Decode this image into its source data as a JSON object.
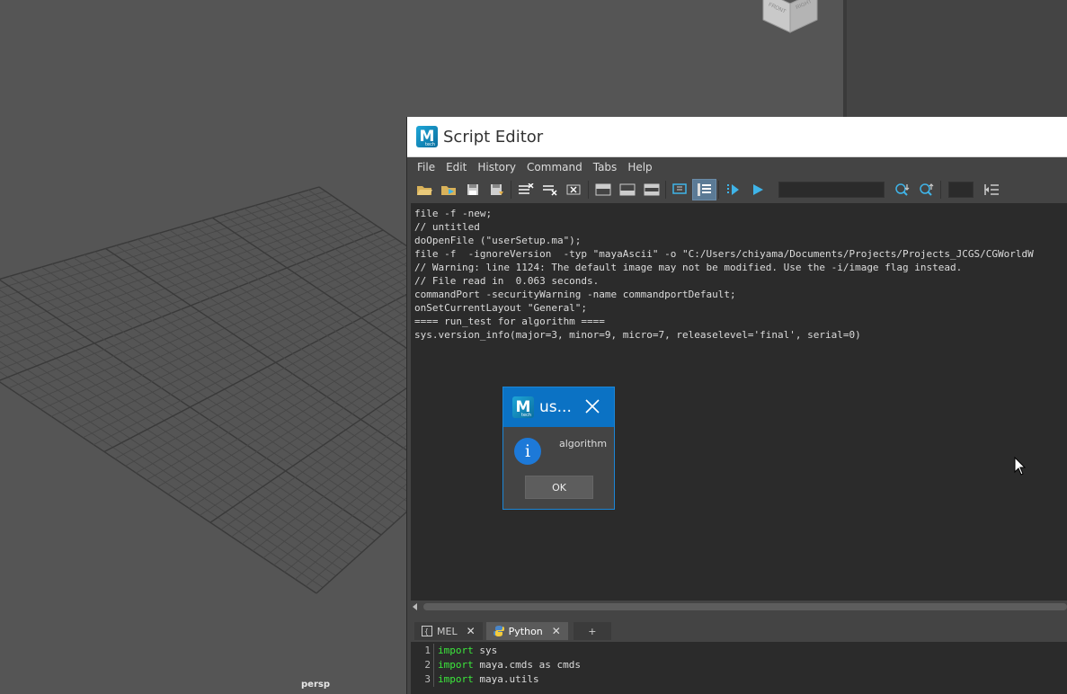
{
  "viewport": {
    "camera_label": "persp",
    "viewcube_faces": [
      "FRONT",
      "RIGHT"
    ]
  },
  "script_editor": {
    "title": "Script Editor",
    "menu": [
      "File",
      "Edit",
      "History",
      "Command",
      "Tabs",
      "Help"
    ],
    "history_lines": [
      "file -f -new;",
      "// untitled",
      "doOpenFile (\"userSetup.ma\");",
      "file -f  -ignoreVersion  -typ \"mayaAscii\" -o \"C:/Users/chiyama/Documents/Projects/Projects_JCGS/CGWorldW",
      "// Warning: line 1124: The default image may not be modified. Use the -i/image flag instead.",
      "// File read in  0.063 seconds.",
      "commandPort -securityWarning -name commandportDefault;",
      "onSetCurrentLayout \"General\";",
      "==== run_test for algorithm ====",
      "sys.version_info(major=3, minor=9, micro=7, releaselevel='final', serial=0)"
    ],
    "tabs": [
      {
        "label": "MEL",
        "active": false
      },
      {
        "label": "Python",
        "active": true
      }
    ],
    "add_tab_label": "+",
    "code_lines": [
      {
        "num": "1",
        "kw": "import",
        "rest": " sys"
      },
      {
        "num": "2",
        "kw": "import",
        "rest": " maya.cmds as cmds"
      },
      {
        "num": "3",
        "kw": "import",
        "rest": " maya.utils"
      }
    ]
  },
  "dialog": {
    "title": "us...",
    "message": "algorithm",
    "ok_label": "OK"
  },
  "logo_text": "M",
  "logo_sub": "tech",
  "colors": {
    "accent_blue": "#0b72c4",
    "keyword_green": "#3ce83c",
    "panel_bg": "#444444",
    "editor_bg": "#2b2b2b"
  }
}
